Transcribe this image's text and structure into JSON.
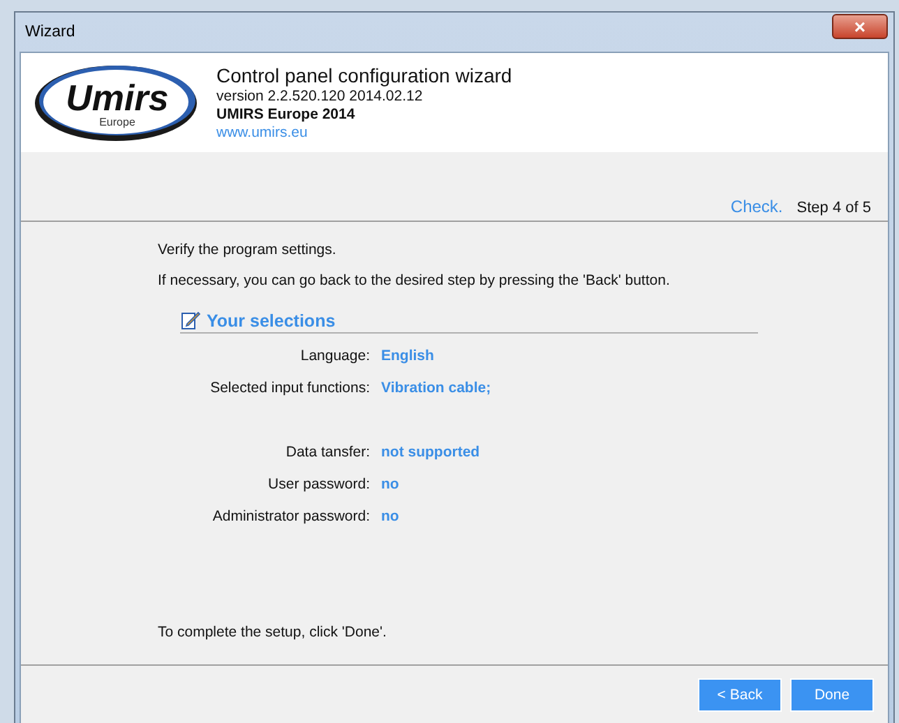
{
  "window": {
    "title": "Wizard",
    "close": "×"
  },
  "header": {
    "logo_text": "Umirs",
    "logo_sub": "Europe",
    "title": "Control panel configuration wizard",
    "version": "version  2.2.520.120 2014.02.12",
    "company": "UMIRS Europe 2014",
    "link": "www.umirs.eu"
  },
  "step": {
    "name": "Check.",
    "counter": "Step  4 of 5"
  },
  "intro": [
    "Verify the program settings.",
    "If necessary, you can go back to the desired step by pressing the 'Back' button."
  ],
  "selections": {
    "heading": "Your selections",
    "rows": [
      {
        "label": "Language:",
        "value": "English"
      },
      {
        "label": "Selected input functions:",
        "value": "Vibration cable;"
      },
      {
        "label": "Data tansfer:",
        "value": "not supported"
      },
      {
        "label": "User password:",
        "value": "no"
      },
      {
        "label": "Administrator password:",
        "value": "no"
      }
    ]
  },
  "footer_text": "To complete the setup, click 'Done'.",
  "buttons": [
    "< Back",
    "Done"
  ]
}
